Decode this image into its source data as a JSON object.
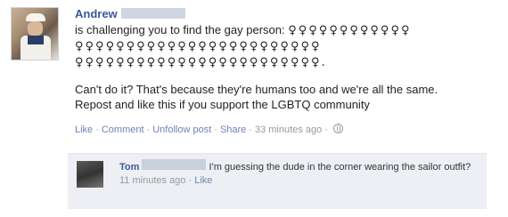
{
  "post": {
    "author": "Andrew",
    "line1": "is challenging you to find the gay person:",
    "symbols_line1": "♀♀♀♀♀♀♀♀♀♀♀♀",
    "symbols_line2": "♀♀♀♀♀♀♀♀♀♀♀♀♀♀♀♀♀♀♀♀♀♀♀♀",
    "symbols_line3": "♀♀♀♀♀♀♀♀♀♀♀♀♀♀♀♀♀♀♀♀♀♀♀♀.",
    "para2_line1": "Can't do it? That's because they're humans too and we're all the same.",
    "para2_line2": "Repost and like this if you support the LGBTQ community",
    "actions": {
      "like": "Like",
      "comment": "Comment",
      "unfollow": "Unfollow post",
      "share": "Share",
      "time": "33 minutes ago"
    }
  },
  "comment": {
    "author": "Tom",
    "text": "I'm guessing the dude in the corner wearing the sailor outfit?",
    "time": "11 minutes ago",
    "like": "Like"
  }
}
